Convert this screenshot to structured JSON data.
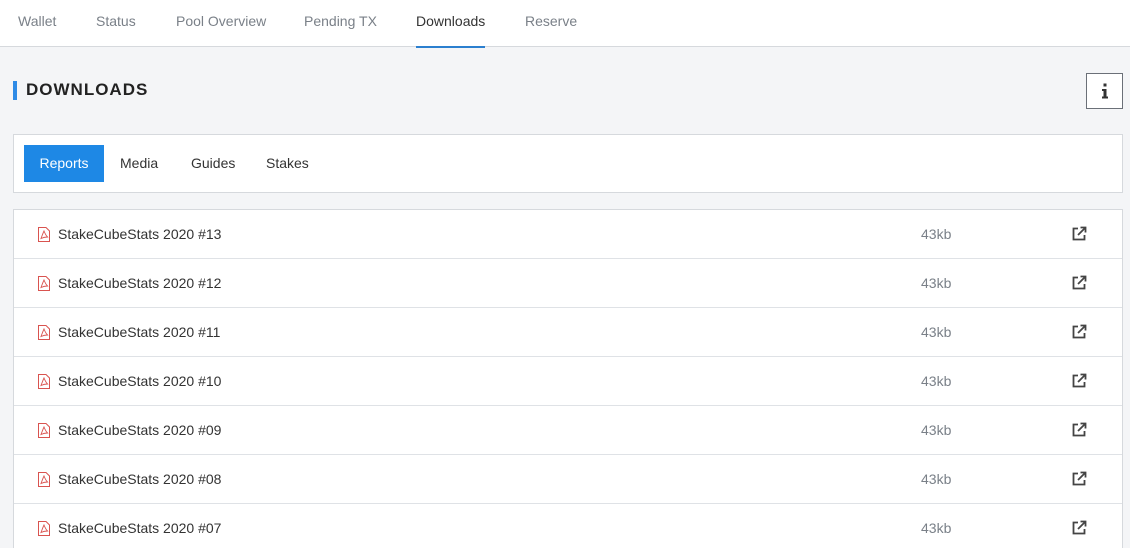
{
  "topnav": {
    "tabs": [
      {
        "label": "Wallet"
      },
      {
        "label": "Status"
      },
      {
        "label": "Pool Overview"
      },
      {
        "label": "Pending TX"
      },
      {
        "label": "Downloads"
      },
      {
        "label": "Reserve"
      }
    ],
    "active_tab": "Downloads"
  },
  "page": {
    "title": "DOWNLOADS",
    "info_icon": "info-icon"
  },
  "subtabs": {
    "items": [
      {
        "label": "Reports"
      },
      {
        "label": "Media"
      },
      {
        "label": "Guides"
      },
      {
        "label": "Stakes"
      }
    ],
    "active": "Reports"
  },
  "downloads": [
    {
      "name": "StakeCubeStats 2020 #13",
      "size": "43kb"
    },
    {
      "name": "StakeCubeStats 2020 #12",
      "size": "43kb"
    },
    {
      "name": "StakeCubeStats 2020 #11",
      "size": "43kb"
    },
    {
      "name": "StakeCubeStats 2020 #10",
      "size": "43kb"
    },
    {
      "name": "StakeCubeStats 2020 #09",
      "size": "43kb"
    },
    {
      "name": "StakeCubeStats 2020 #08",
      "size": "43kb"
    },
    {
      "name": "StakeCubeStats 2020 #07",
      "size": "43kb"
    }
  ],
  "icons": {
    "file": "file-pdf-icon",
    "open": "external-link-icon"
  },
  "colors": {
    "accent": "#1e88e5",
    "heading_bar": "#2f8be6",
    "pdf_icon": "#d9534f"
  }
}
